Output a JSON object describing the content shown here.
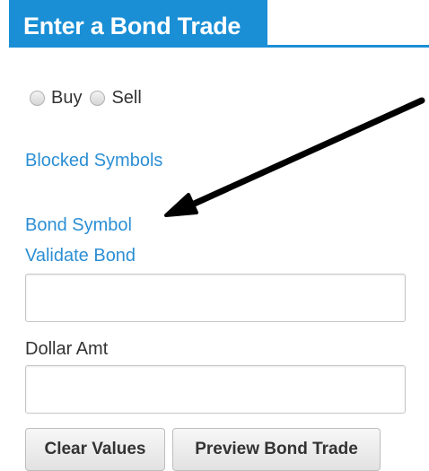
{
  "header": {
    "title": "Enter a Bond Trade",
    "accent_color": "#1a8fd6"
  },
  "trade_side": {
    "options": [
      "Buy",
      "Sell"
    ],
    "selected": null
  },
  "links": {
    "blocked_symbols": "Blocked Symbols",
    "bond_symbol": "Bond Symbol",
    "validate_bond": "Validate Bond"
  },
  "fields": {
    "bond_symbol_value": "",
    "dollar_amt_label": "Dollar Amt",
    "dollar_amt_value": ""
  },
  "buttons": {
    "clear_values": "Clear Values",
    "preview_bond_trade": "Preview Bond Trade"
  },
  "annotation": {
    "arrow_icon": "arrow-pointing-left-icon",
    "arrow_color": "#000000"
  }
}
